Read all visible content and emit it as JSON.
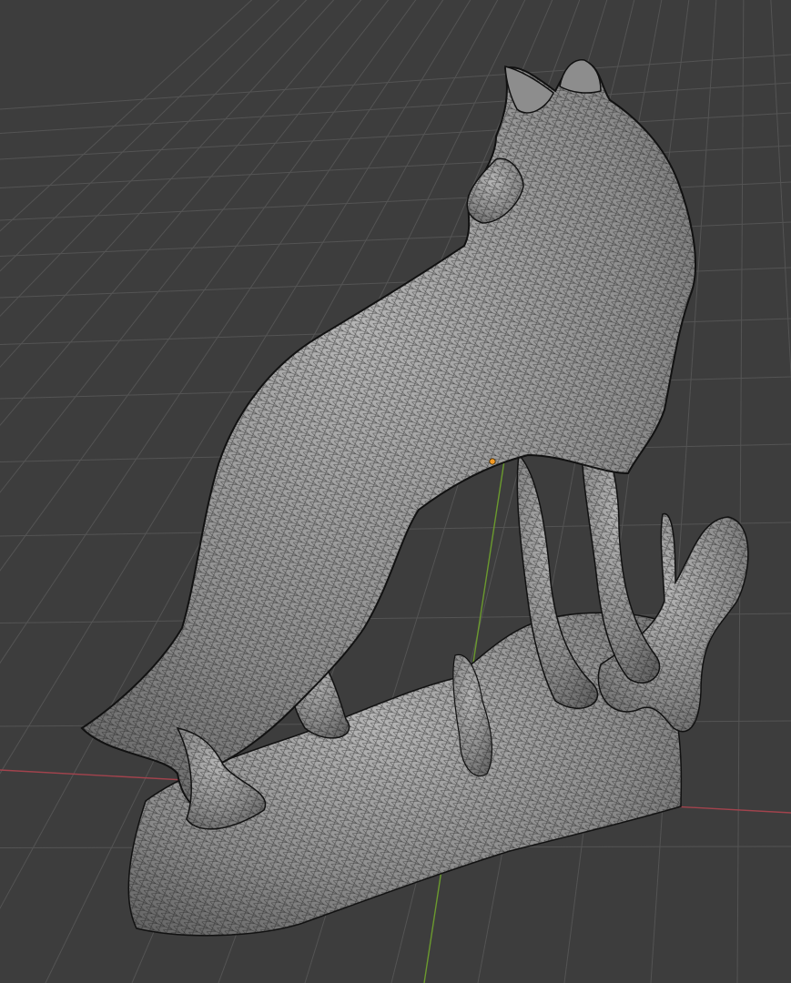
{
  "viewport": {
    "mode": "3D Viewport",
    "background_color": "#3d3d3d",
    "grid_color": "#545454",
    "x_axis_color": "#a2434d",
    "y_axis_color": "#6b9a2e",
    "mesh_fill_color": "#9a9a9a",
    "wire_color": "#151515",
    "origin_color": "#f29a25"
  },
  "object": {
    "name": "wolf-sculpture-mesh",
    "display": "wireframe-overlay",
    "parts": [
      "body",
      "head",
      "ears",
      "legs",
      "tail",
      "rock-base",
      "branch"
    ]
  }
}
